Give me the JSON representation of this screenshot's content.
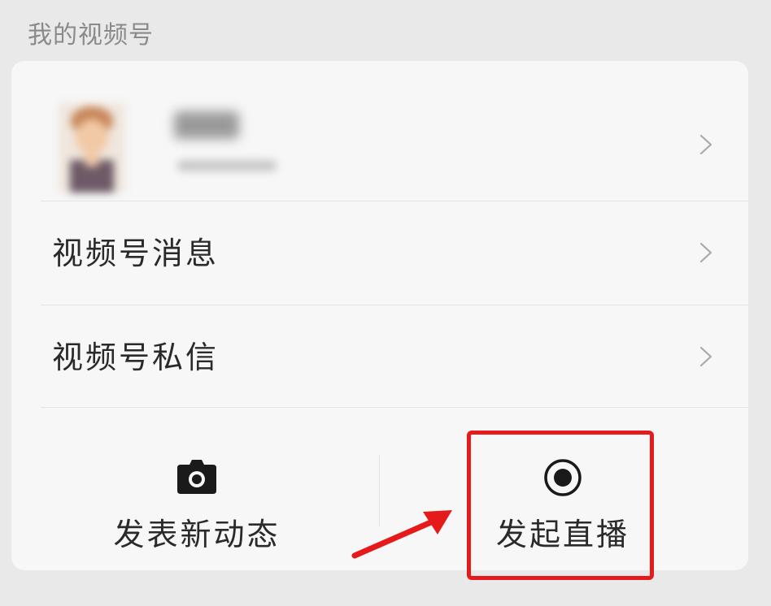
{
  "section": {
    "title": "我的视频号"
  },
  "menu": {
    "items": [
      {
        "label": "视频号消息"
      },
      {
        "label": "视频号私信"
      }
    ]
  },
  "actions": {
    "post_label": "发表新动态",
    "post_icon": "camera-icon",
    "live_label": "发起直播",
    "live_icon": "record-icon"
  },
  "annotation": {
    "highlight_color": "#e51b1b"
  },
  "icons": {
    "chevron": "chevron-right-icon"
  }
}
